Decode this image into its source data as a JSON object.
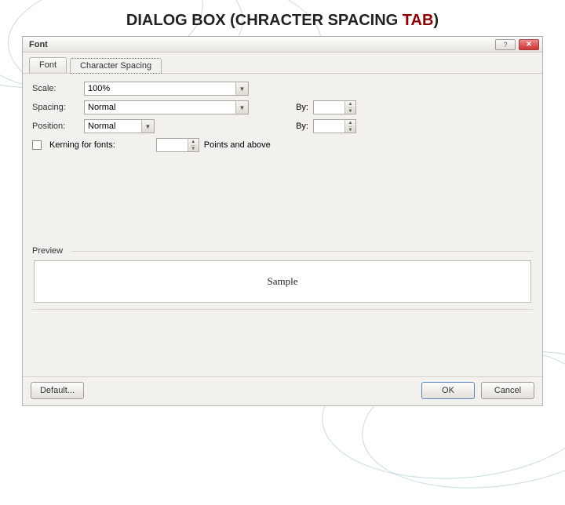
{
  "slide_title": {
    "prefix": "DIALOG BOX (CHRACTER SPACING ",
    "tab_word": "TAB",
    "suffix": ")"
  },
  "dialog": {
    "title": "Font",
    "help_label": "?",
    "close_label": "✕",
    "tabs": {
      "font": "Font",
      "character_spacing": "Character Spacing"
    },
    "fields": {
      "scale_label": "Scale:",
      "scale_value": "100%",
      "spacing_label": "Spacing:",
      "spacing_value": "Normal",
      "spacing_by_label": "By:",
      "spacing_by_value": "",
      "position_label": "Position:",
      "position_value": "Normal",
      "position_by_label": "By:",
      "position_by_value": "",
      "kerning_label": "Kerning for fonts:",
      "kerning_value": "",
      "kerning_suffix": "Points and above"
    },
    "preview": {
      "label": "Preview",
      "sample_text": "Sample"
    },
    "buttons": {
      "default": "Default...",
      "ok": "OK",
      "cancel": "Cancel"
    }
  }
}
